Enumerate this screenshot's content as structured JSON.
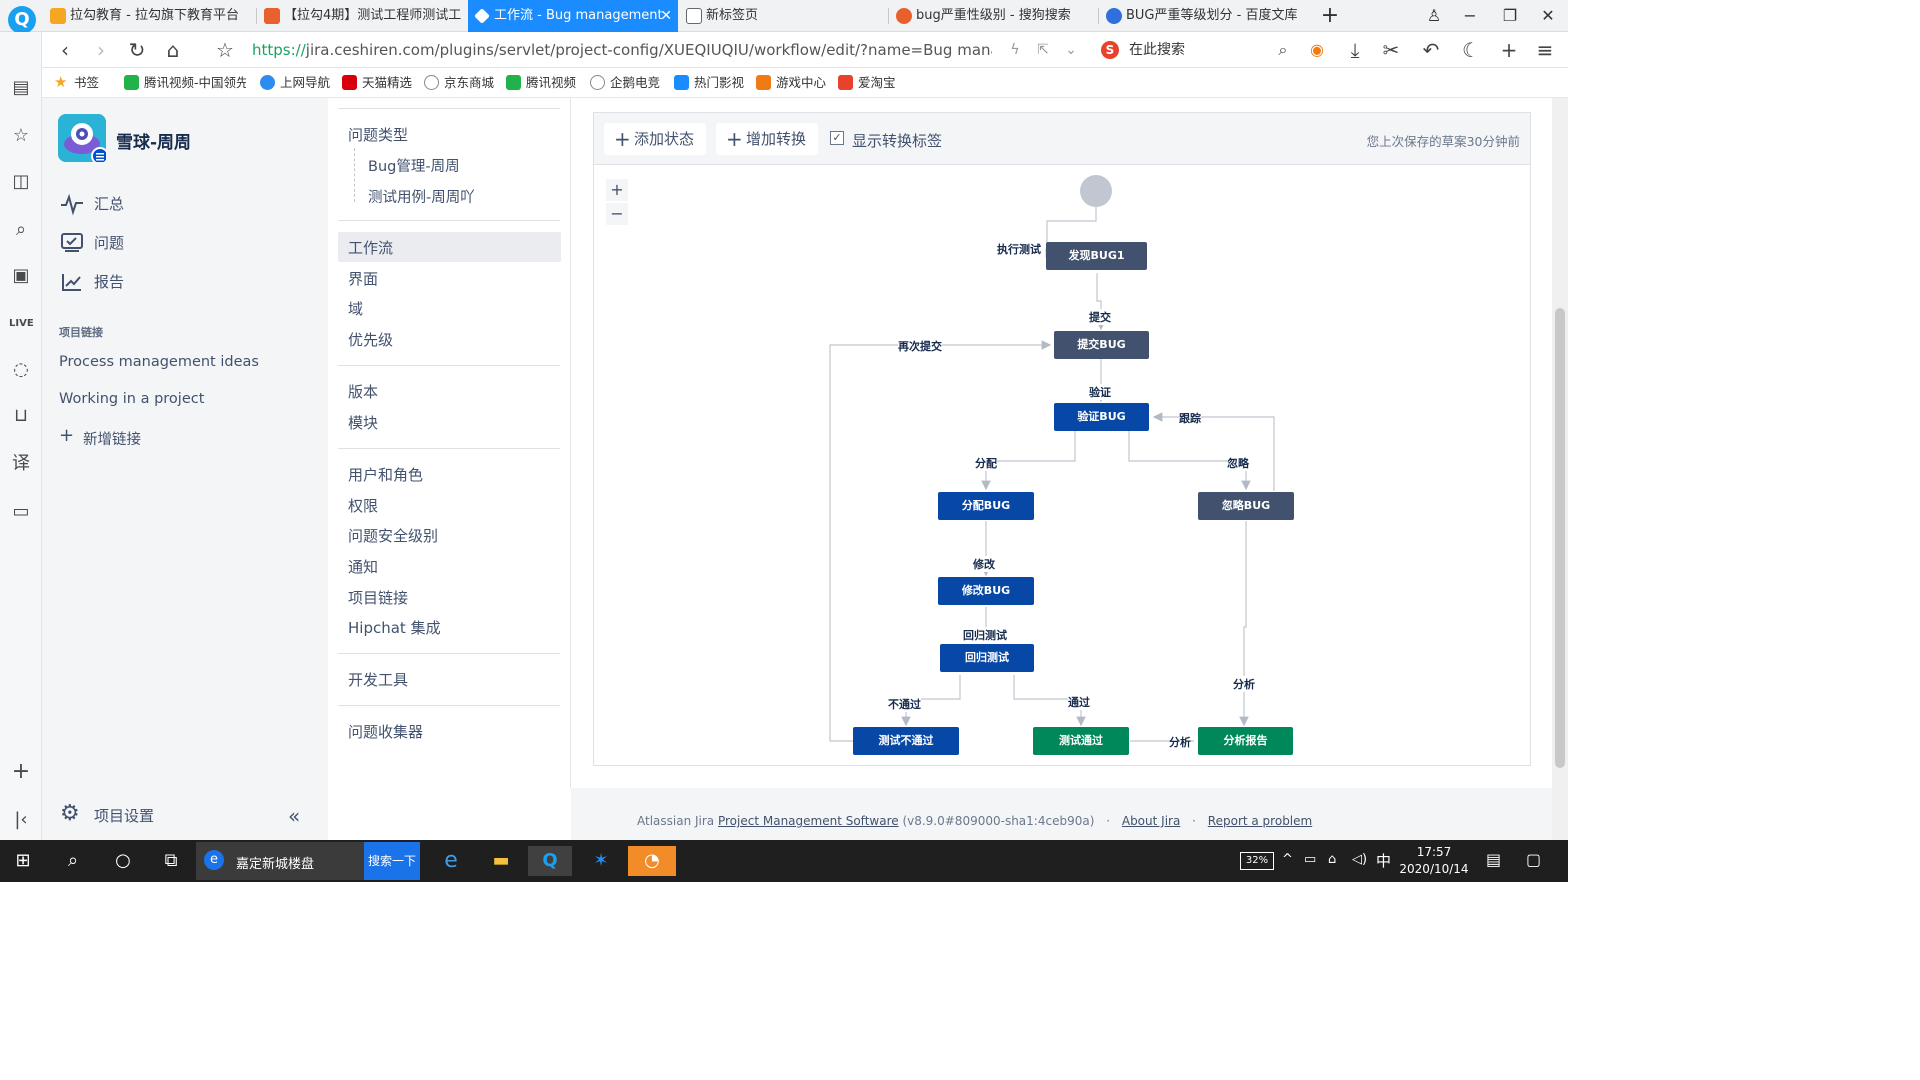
{
  "browser": {
    "tabs": [
      {
        "label": "拉勾教育 - 拉勾旗下教育平台"
      },
      {
        "label": "【拉勾4期】测试工程师测试工"
      },
      {
        "label": "工作流 - Bug management"
      },
      {
        "label": "新标签页"
      },
      {
        "label": "bug严重性级别 - 搜狗搜索"
      },
      {
        "label": "BUG严重等级划分 - 百度文库"
      }
    ],
    "url_scheme": "https://",
    "url_rest": "jira.ceshiren.com/plugins/servlet/project-config/XUEQIUQIU/workflow/edit/?name=Bug manageme",
    "search_placeholder": "在此搜索",
    "bookmarks": [
      "书签",
      "腾讯视频-中国领先",
      "上网导航",
      "天猫精选",
      "京东商城",
      "腾讯视频",
      "企鹅电竞",
      "热门影视",
      "游戏中心",
      "爱淘宝"
    ]
  },
  "sidebar": {
    "project_name": "雪球-周周",
    "nav": [
      {
        "label": "汇总"
      },
      {
        "label": "问题"
      },
      {
        "label": "报告"
      }
    ],
    "links_heading": "项目链接",
    "links": [
      "Process management ideas",
      "Working in a project"
    ],
    "add_link": "新增链接",
    "settings": "项目设置"
  },
  "admin_menu": {
    "issue_types": "问题类型",
    "issue_type_items": [
      "Bug管理-周周",
      "测试用例-周周吖"
    ],
    "group1": [
      "工作流",
      "界面",
      "域",
      "优先级"
    ],
    "group2": [
      "版本",
      "模块"
    ],
    "group3": [
      "用户和角色",
      "权限",
      "问题安全级别",
      "通知",
      "项目链接",
      "Hipchat 集成"
    ],
    "group4": [
      "开发工具"
    ],
    "group5": [
      "问题收集器"
    ]
  },
  "editor": {
    "add_status": "添加状态",
    "add_transition": "增加转换",
    "show_labels": "显示转换标签",
    "show_labels_checked": true,
    "saved_note": "您上次保存的草案30分钟前",
    "statuses": {
      "found": "发现BUG1",
      "submit": "提交BUG",
      "verify": "验证BUG",
      "assign": "分配BUG",
      "ignore": "忽略BUG",
      "fix": "修改BUG",
      "regress": "回归测试",
      "fail": "测试不通过",
      "pass": "测试通过",
      "report": "分析报告"
    },
    "transitions": {
      "execute": "执行测试",
      "submit": "提交",
      "resubmit": "再次提交",
      "verify": "验证",
      "track": "跟踪",
      "assign": "分配",
      "ignore": "忽略",
      "modify": "修改",
      "regress": "回归测试",
      "not_pass": "不通过",
      "pass": "通过",
      "analyze1": "分析",
      "analyze2": "分析"
    },
    "status_colors": {
      "todo": "#42526e",
      "in_progress": "#0747a6",
      "done": "#00875a"
    }
  },
  "footer": {
    "prefix": "Atlassian Jira ",
    "pm_link": "Project Management Software",
    "version": " (v8.9.0#809000-sha1:4ceb90a)",
    "about": "About Jira",
    "report": "Report a problem"
  },
  "taskbar": {
    "search_text": "嘉定新城楼盘",
    "search_button": "搜索一下",
    "battery": "32%",
    "ime": "中",
    "time": "17:57",
    "date": "2020/10/14"
  }
}
